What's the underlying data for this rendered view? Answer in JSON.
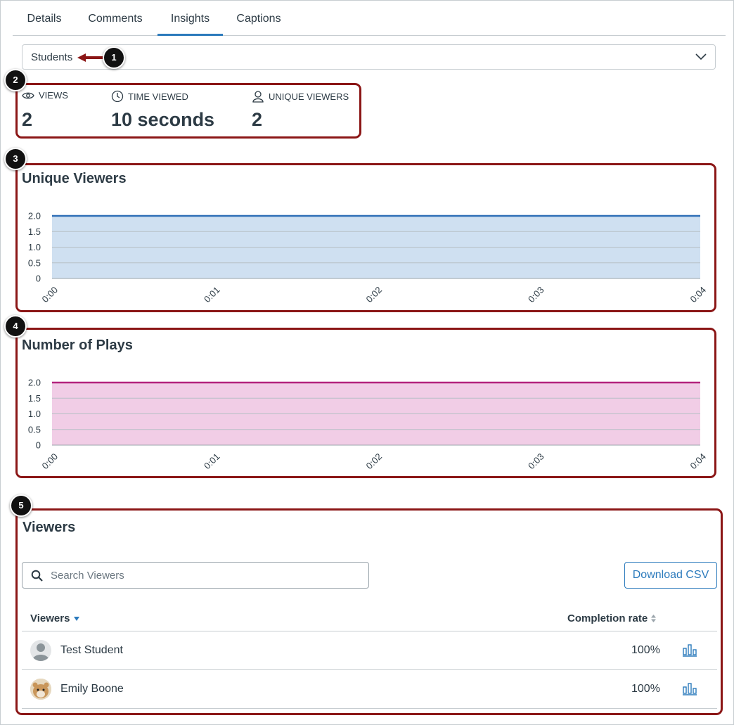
{
  "tabs": [
    "Details",
    "Comments",
    "Insights",
    "Captions"
  ],
  "viewer_filter": {
    "selected": "Students"
  },
  "callouts": [
    "1",
    "2",
    "3",
    "4",
    "5"
  ],
  "stats": [
    {
      "label": "VIEWS",
      "value": "2",
      "icon": "eye-icon"
    },
    {
      "label": "TIME VIEWED",
      "value": "10 seconds",
      "icon": "clock-icon"
    },
    {
      "label": "UNIQUE VIEWERS",
      "value": "2",
      "icon": "user-icon"
    }
  ],
  "chart_data": [
    {
      "type": "area",
      "title": "Unique Viewers",
      "x": [
        "0:00",
        "0:01",
        "0:02",
        "0:03",
        "0:04"
      ],
      "values": [
        2,
        2,
        2,
        2,
        2
      ],
      "yticks": [
        "0",
        "0.5",
        "1.0",
        "1.5",
        "2.0"
      ],
      "ylim": [
        0,
        2
      ],
      "grid": true,
      "color": "#2f6fb7",
      "fill": "#cfe0f1"
    },
    {
      "type": "area",
      "title": "Number of Plays",
      "x": [
        "0:00",
        "0:01",
        "0:02",
        "0:03",
        "0:04"
      ],
      "values": [
        2,
        2,
        2,
        2,
        2
      ],
      "yticks": [
        "0",
        "0.5",
        "1.0",
        "1.5",
        "2.0"
      ],
      "ylim": [
        0,
        2
      ],
      "grid": true,
      "color": "#b3237d",
      "fill": "#f1cde6"
    }
  ],
  "viewers": {
    "title": "Viewers",
    "search_placeholder": "Search Viewers",
    "download_label": "Download CSV",
    "col_viewers": "Viewers",
    "col_completion": "Completion rate",
    "rows": [
      {
        "name": "Test Student",
        "completion": "100%"
      },
      {
        "name": "Emily Boone",
        "completion": "100%"
      }
    ]
  }
}
